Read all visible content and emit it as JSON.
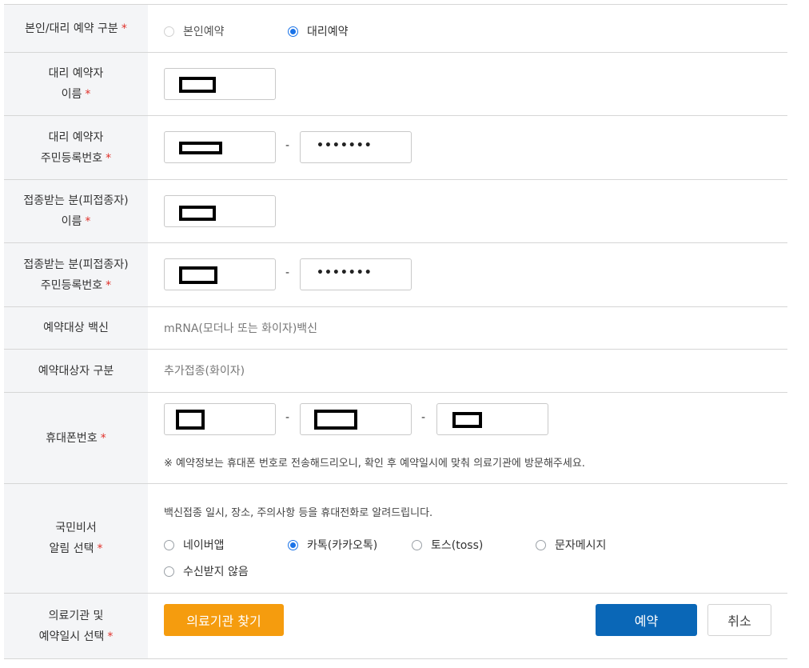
{
  "rows": {
    "type": {
      "label": "본인/대리 예약 구분",
      "required": "*",
      "options": [
        "본인예약",
        "대리예약"
      ],
      "selected": "대리예약"
    },
    "proxy_name": {
      "label_line1": "대리 예약자",
      "label_line2": "이름",
      "required": "*"
    },
    "proxy_rrn": {
      "label_line1": "대리 예약자",
      "label_line2": "주민등록번호",
      "required": "*",
      "dash": "-",
      "masked": "•••••••"
    },
    "recipient_name": {
      "label_line1": "접종받는 분(피접종자)",
      "label_line2": "이름",
      "required": "*"
    },
    "recipient_rrn": {
      "label_line1": "접종받는 분(피접종자)",
      "label_line2": "주민등록번호",
      "required": "*",
      "dash": "-",
      "masked": "•••••••"
    },
    "vaccine": {
      "label": "예약대상 백신",
      "value": "mRNA(모더나 또는 화이자)백신"
    },
    "category": {
      "label": "예약대상자 구분",
      "value": "추가접종(화이자)"
    },
    "phone": {
      "label": "휴대폰번호",
      "required": "*",
      "dash": "-",
      "notice": "※ 예약정보는 휴대폰 번호로 전송해드리오니, 확인 후 예약일시에 맞춰 의료기관에 방문해주세요."
    },
    "notify": {
      "label_line1": "국민비서",
      "label_line2": "알림 선택",
      "required": "*",
      "description": "백신접종 일시, 장소, 주의사항 등을 휴대전화로 알려드립니다.",
      "options": [
        "네이버앱",
        "카톡(카카오톡)",
        "토스(toss)",
        "문자메시지",
        "수신받지 않음"
      ],
      "selected": "카톡(카카오톡)"
    },
    "facility": {
      "label_line1": "의료기관 및",
      "label_line2": "예약일시 선택",
      "required": "*",
      "find_button": "의료기관 찾기",
      "reserve_button": "예약",
      "cancel_button": "취소"
    }
  },
  "colors": {
    "accent_blue": "#0a67b7",
    "accent_orange": "#f59c0e",
    "required_red": "#e0312a",
    "radio_blue": "#1a73e8"
  }
}
